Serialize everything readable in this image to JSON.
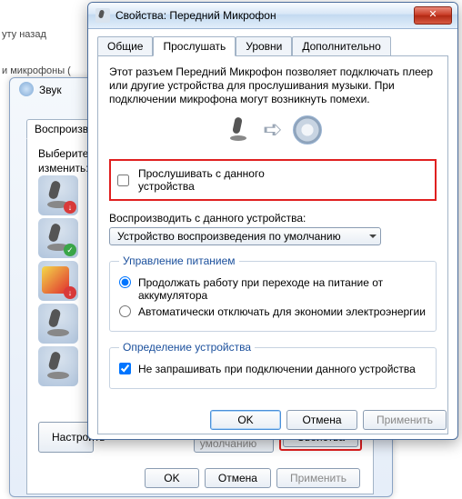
{
  "page_hints": {
    "history": "уту назад",
    "breadcrumb": "и микрофоны ("
  },
  "sound_window": {
    "title": "Звук",
    "tab_playback": "Воспроизведе",
    "select_text": "Выберите у\nизменить:",
    "btn_configure": "Настроить",
    "combo_default": "По умолчанию",
    "btn_properties": "Свойства",
    "btn_ok": "OK",
    "btn_cancel": "Отмена",
    "btn_apply": "Применить"
  },
  "props_window": {
    "title": "Свойства: Передний Микрофон",
    "tabs": [
      "Общие",
      "Прослушать",
      "Уровни",
      "Дополнительно"
    ],
    "description": "Этот разъем Передний Микрофон позволяет подключать плеер или другие устройства для прослушивания музыки. При подключении микрофона могут возникнуть помехи.",
    "listen_checkbox": "Прослушивать с данного устройства",
    "playback_label": "Воспроизводить с данного устройства:",
    "playback_device": "Устройство воспроизведения по умолчанию",
    "power_group": "Управление питанием",
    "power_opt1": "Продолжать работу при переходе на питание от аккумулятора",
    "power_opt2": "Автоматически отключать для экономии электроэнергии",
    "detect_group": "Определение устройства",
    "detect_check": "Не запрашивать при подключении данного устройства",
    "btn_ok": "OK",
    "btn_cancel": "Отмена",
    "btn_apply": "Применить"
  }
}
